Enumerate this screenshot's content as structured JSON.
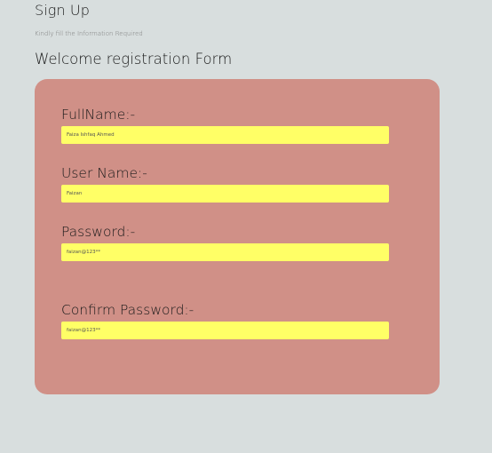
{
  "header": {
    "title": "Sign Up",
    "subtitle": "Kindly fill the Information Required",
    "form_heading": "Welcome registration Form"
  },
  "form": {
    "fields": [
      {
        "label": "FullName:-",
        "value": "Faiza Ishfaq Ahmed"
      },
      {
        "label": "User Name:-",
        "value": "Faizan"
      },
      {
        "label": "Password:-",
        "value": "faizan@123**"
      },
      {
        "label": "Confirm Password:-",
        "value": "faizan@123**"
      }
    ]
  },
  "colors": {
    "page_background": "#d8dede",
    "panel_background": "#d09087",
    "input_background": "#ffff66"
  }
}
